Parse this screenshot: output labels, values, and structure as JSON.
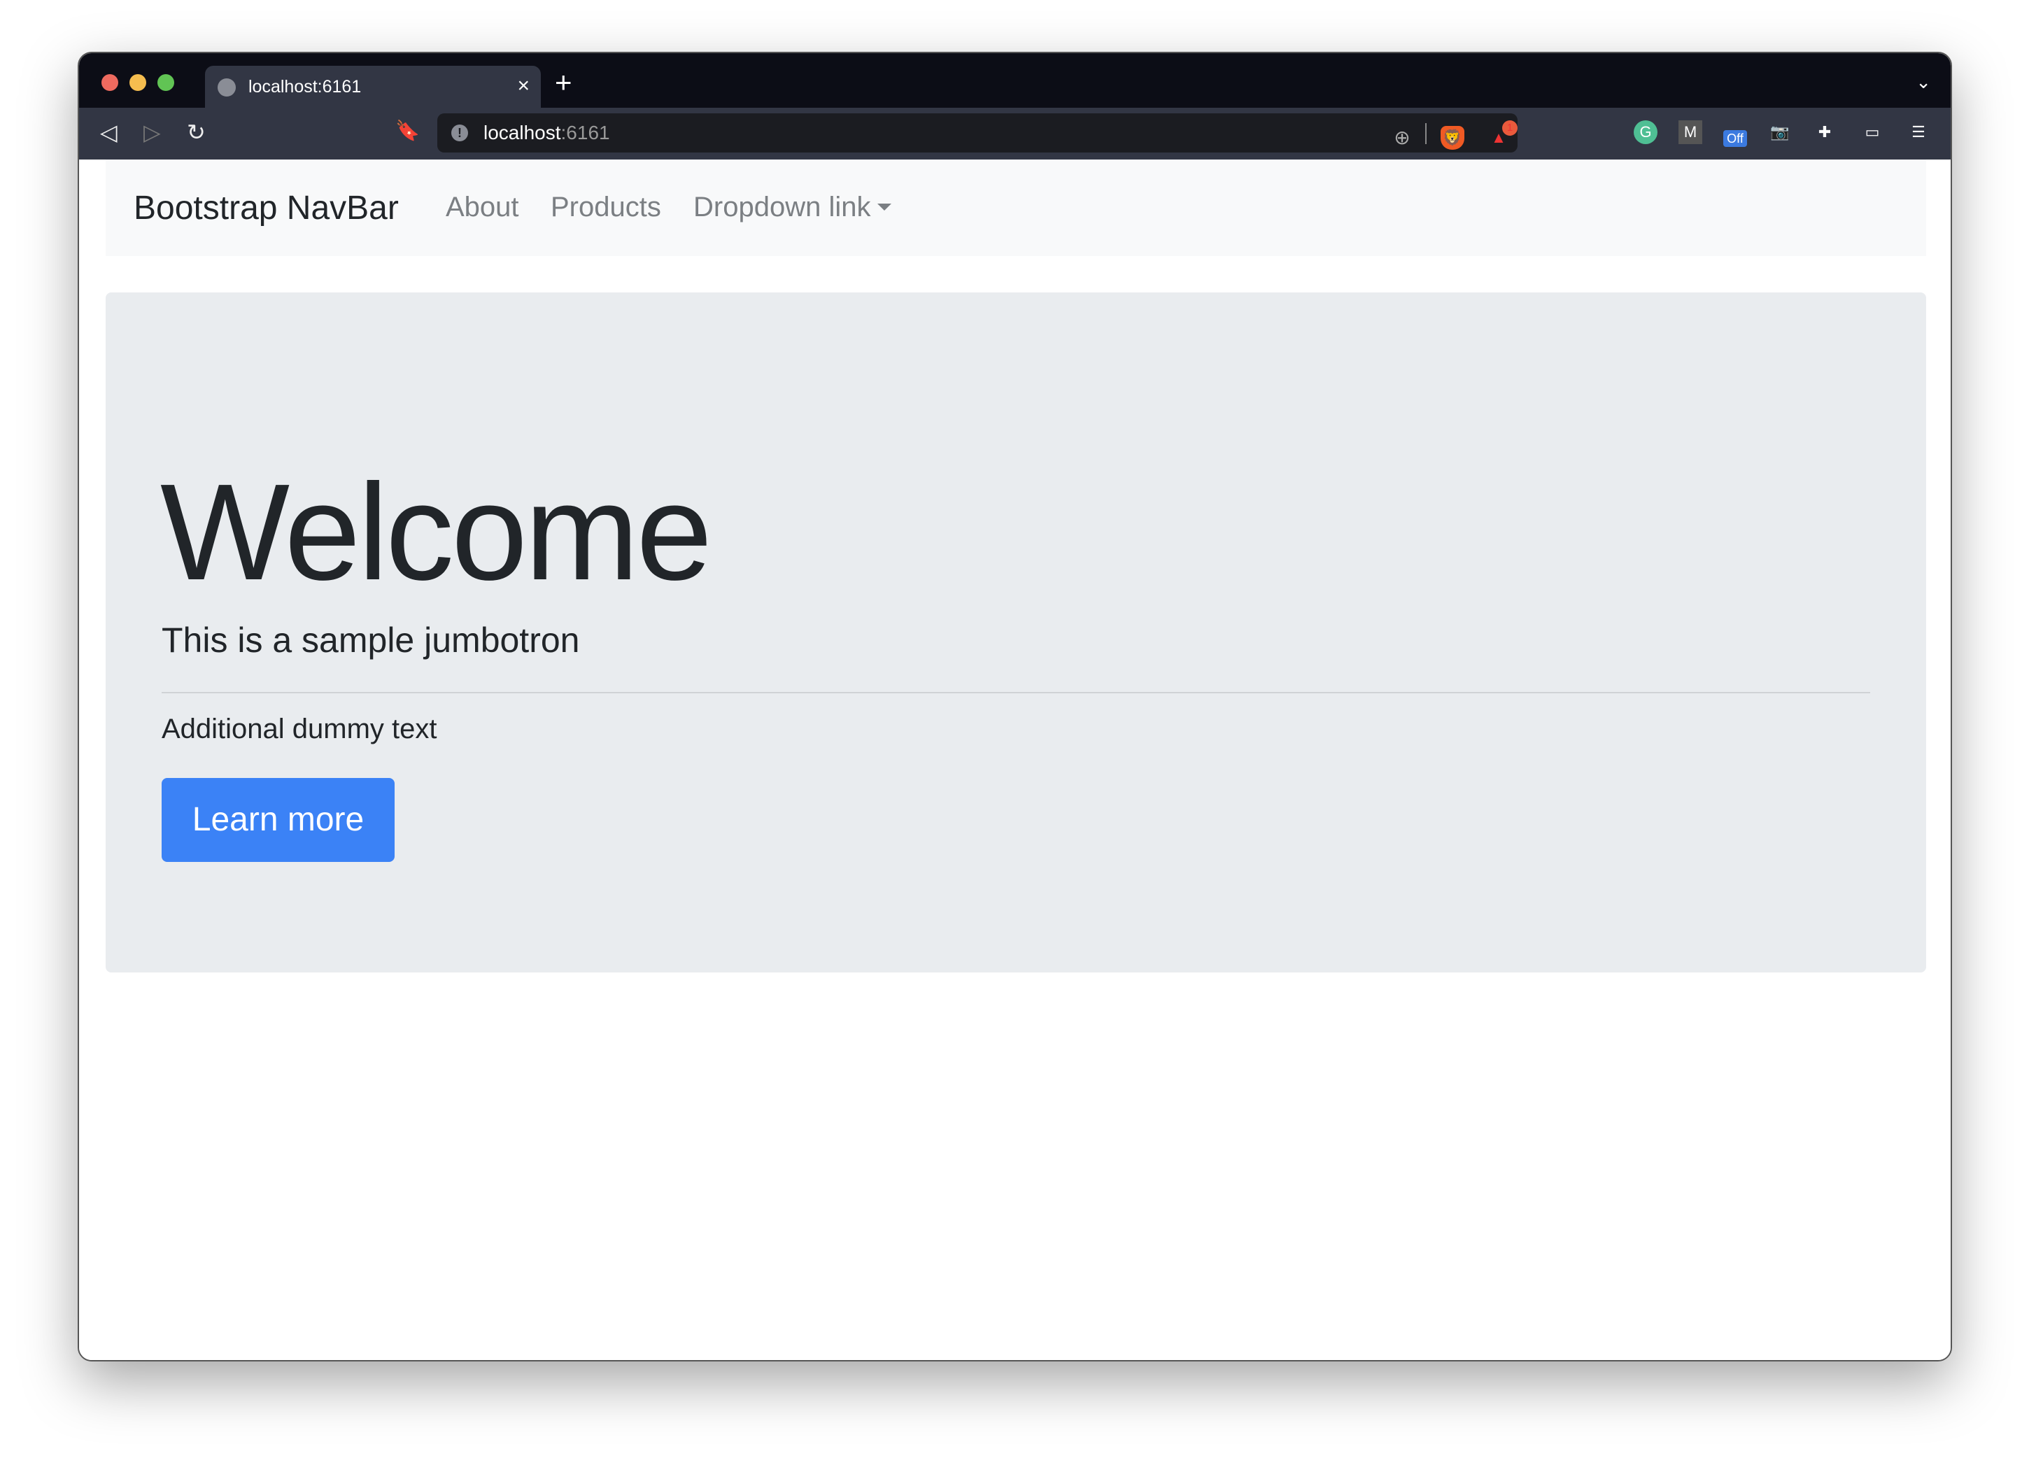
{
  "browser": {
    "tab_title": "localhost:6161",
    "url_host": "localhost",
    "url_port": ":6161",
    "badge_count": "1",
    "ext_off": "Off",
    "ext_m": "M",
    "ext_g": "G"
  },
  "navbar": {
    "brand": "Bootstrap NavBar",
    "links": [
      "About",
      "Products",
      "Dropdown link"
    ]
  },
  "jumbotron": {
    "title": "Welcome",
    "lead": "This is a sample jumbotron",
    "text": "Additional dummy text",
    "button": "Learn more"
  },
  "colors": {
    "primary": "#3b82f6",
    "jumbotron_bg": "#e9ecef",
    "navbar_bg": "#f8f9fa"
  }
}
